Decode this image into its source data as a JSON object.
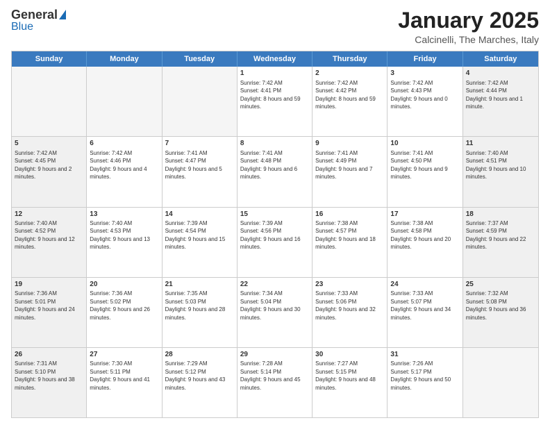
{
  "logo": {
    "general": "General",
    "blue": "Blue"
  },
  "header": {
    "title": "January 2025",
    "subtitle": "Calcinelli, The Marches, Italy"
  },
  "days": [
    "Sunday",
    "Monday",
    "Tuesday",
    "Wednesday",
    "Thursday",
    "Friday",
    "Saturday"
  ],
  "weeks": [
    [
      {
        "day": "",
        "text": "",
        "empty": true
      },
      {
        "day": "",
        "text": "",
        "empty": true
      },
      {
        "day": "",
        "text": "",
        "empty": true
      },
      {
        "day": "1",
        "text": "Sunrise: 7:42 AM\nSunset: 4:41 PM\nDaylight: 8 hours and 59 minutes.",
        "shaded": false
      },
      {
        "day": "2",
        "text": "Sunrise: 7:42 AM\nSunset: 4:42 PM\nDaylight: 8 hours and 59 minutes.",
        "shaded": false
      },
      {
        "day": "3",
        "text": "Sunrise: 7:42 AM\nSunset: 4:43 PM\nDaylight: 9 hours and 0 minutes.",
        "shaded": false
      },
      {
        "day": "4",
        "text": "Sunrise: 7:42 AM\nSunset: 4:44 PM\nDaylight: 9 hours and 1 minute.",
        "shaded": true
      }
    ],
    [
      {
        "day": "5",
        "text": "Sunrise: 7:42 AM\nSunset: 4:45 PM\nDaylight: 9 hours and 2 minutes.",
        "shaded": true
      },
      {
        "day": "6",
        "text": "Sunrise: 7:42 AM\nSunset: 4:46 PM\nDaylight: 9 hours and 4 minutes.",
        "shaded": false
      },
      {
        "day": "7",
        "text": "Sunrise: 7:41 AM\nSunset: 4:47 PM\nDaylight: 9 hours and 5 minutes.",
        "shaded": false
      },
      {
        "day": "8",
        "text": "Sunrise: 7:41 AM\nSunset: 4:48 PM\nDaylight: 9 hours and 6 minutes.",
        "shaded": false
      },
      {
        "day": "9",
        "text": "Sunrise: 7:41 AM\nSunset: 4:49 PM\nDaylight: 9 hours and 7 minutes.",
        "shaded": false
      },
      {
        "day": "10",
        "text": "Sunrise: 7:41 AM\nSunset: 4:50 PM\nDaylight: 9 hours and 9 minutes.",
        "shaded": false
      },
      {
        "day": "11",
        "text": "Sunrise: 7:40 AM\nSunset: 4:51 PM\nDaylight: 9 hours and 10 minutes.",
        "shaded": true
      }
    ],
    [
      {
        "day": "12",
        "text": "Sunrise: 7:40 AM\nSunset: 4:52 PM\nDaylight: 9 hours and 12 minutes.",
        "shaded": true
      },
      {
        "day": "13",
        "text": "Sunrise: 7:40 AM\nSunset: 4:53 PM\nDaylight: 9 hours and 13 minutes.",
        "shaded": false
      },
      {
        "day": "14",
        "text": "Sunrise: 7:39 AM\nSunset: 4:54 PM\nDaylight: 9 hours and 15 minutes.",
        "shaded": false
      },
      {
        "day": "15",
        "text": "Sunrise: 7:39 AM\nSunset: 4:56 PM\nDaylight: 9 hours and 16 minutes.",
        "shaded": false
      },
      {
        "day": "16",
        "text": "Sunrise: 7:38 AM\nSunset: 4:57 PM\nDaylight: 9 hours and 18 minutes.",
        "shaded": false
      },
      {
        "day": "17",
        "text": "Sunrise: 7:38 AM\nSunset: 4:58 PM\nDaylight: 9 hours and 20 minutes.",
        "shaded": false
      },
      {
        "day": "18",
        "text": "Sunrise: 7:37 AM\nSunset: 4:59 PM\nDaylight: 9 hours and 22 minutes.",
        "shaded": true
      }
    ],
    [
      {
        "day": "19",
        "text": "Sunrise: 7:36 AM\nSunset: 5:01 PM\nDaylight: 9 hours and 24 minutes.",
        "shaded": true
      },
      {
        "day": "20",
        "text": "Sunrise: 7:36 AM\nSunset: 5:02 PM\nDaylight: 9 hours and 26 minutes.",
        "shaded": false
      },
      {
        "day": "21",
        "text": "Sunrise: 7:35 AM\nSunset: 5:03 PM\nDaylight: 9 hours and 28 minutes.",
        "shaded": false
      },
      {
        "day": "22",
        "text": "Sunrise: 7:34 AM\nSunset: 5:04 PM\nDaylight: 9 hours and 30 minutes.",
        "shaded": false
      },
      {
        "day": "23",
        "text": "Sunrise: 7:33 AM\nSunset: 5:06 PM\nDaylight: 9 hours and 32 minutes.",
        "shaded": false
      },
      {
        "day": "24",
        "text": "Sunrise: 7:33 AM\nSunset: 5:07 PM\nDaylight: 9 hours and 34 minutes.",
        "shaded": false
      },
      {
        "day": "25",
        "text": "Sunrise: 7:32 AM\nSunset: 5:08 PM\nDaylight: 9 hours and 36 minutes.",
        "shaded": true
      }
    ],
    [
      {
        "day": "26",
        "text": "Sunrise: 7:31 AM\nSunset: 5:10 PM\nDaylight: 9 hours and 38 minutes.",
        "shaded": true
      },
      {
        "day": "27",
        "text": "Sunrise: 7:30 AM\nSunset: 5:11 PM\nDaylight: 9 hours and 41 minutes.",
        "shaded": false
      },
      {
        "day": "28",
        "text": "Sunrise: 7:29 AM\nSunset: 5:12 PM\nDaylight: 9 hours and 43 minutes.",
        "shaded": false
      },
      {
        "day": "29",
        "text": "Sunrise: 7:28 AM\nSunset: 5:14 PM\nDaylight: 9 hours and 45 minutes.",
        "shaded": false
      },
      {
        "day": "30",
        "text": "Sunrise: 7:27 AM\nSunset: 5:15 PM\nDaylight: 9 hours and 48 minutes.",
        "shaded": false
      },
      {
        "day": "31",
        "text": "Sunrise: 7:26 AM\nSunset: 5:17 PM\nDaylight: 9 hours and 50 minutes.",
        "shaded": false
      },
      {
        "day": "",
        "text": "",
        "empty": true
      }
    ]
  ]
}
